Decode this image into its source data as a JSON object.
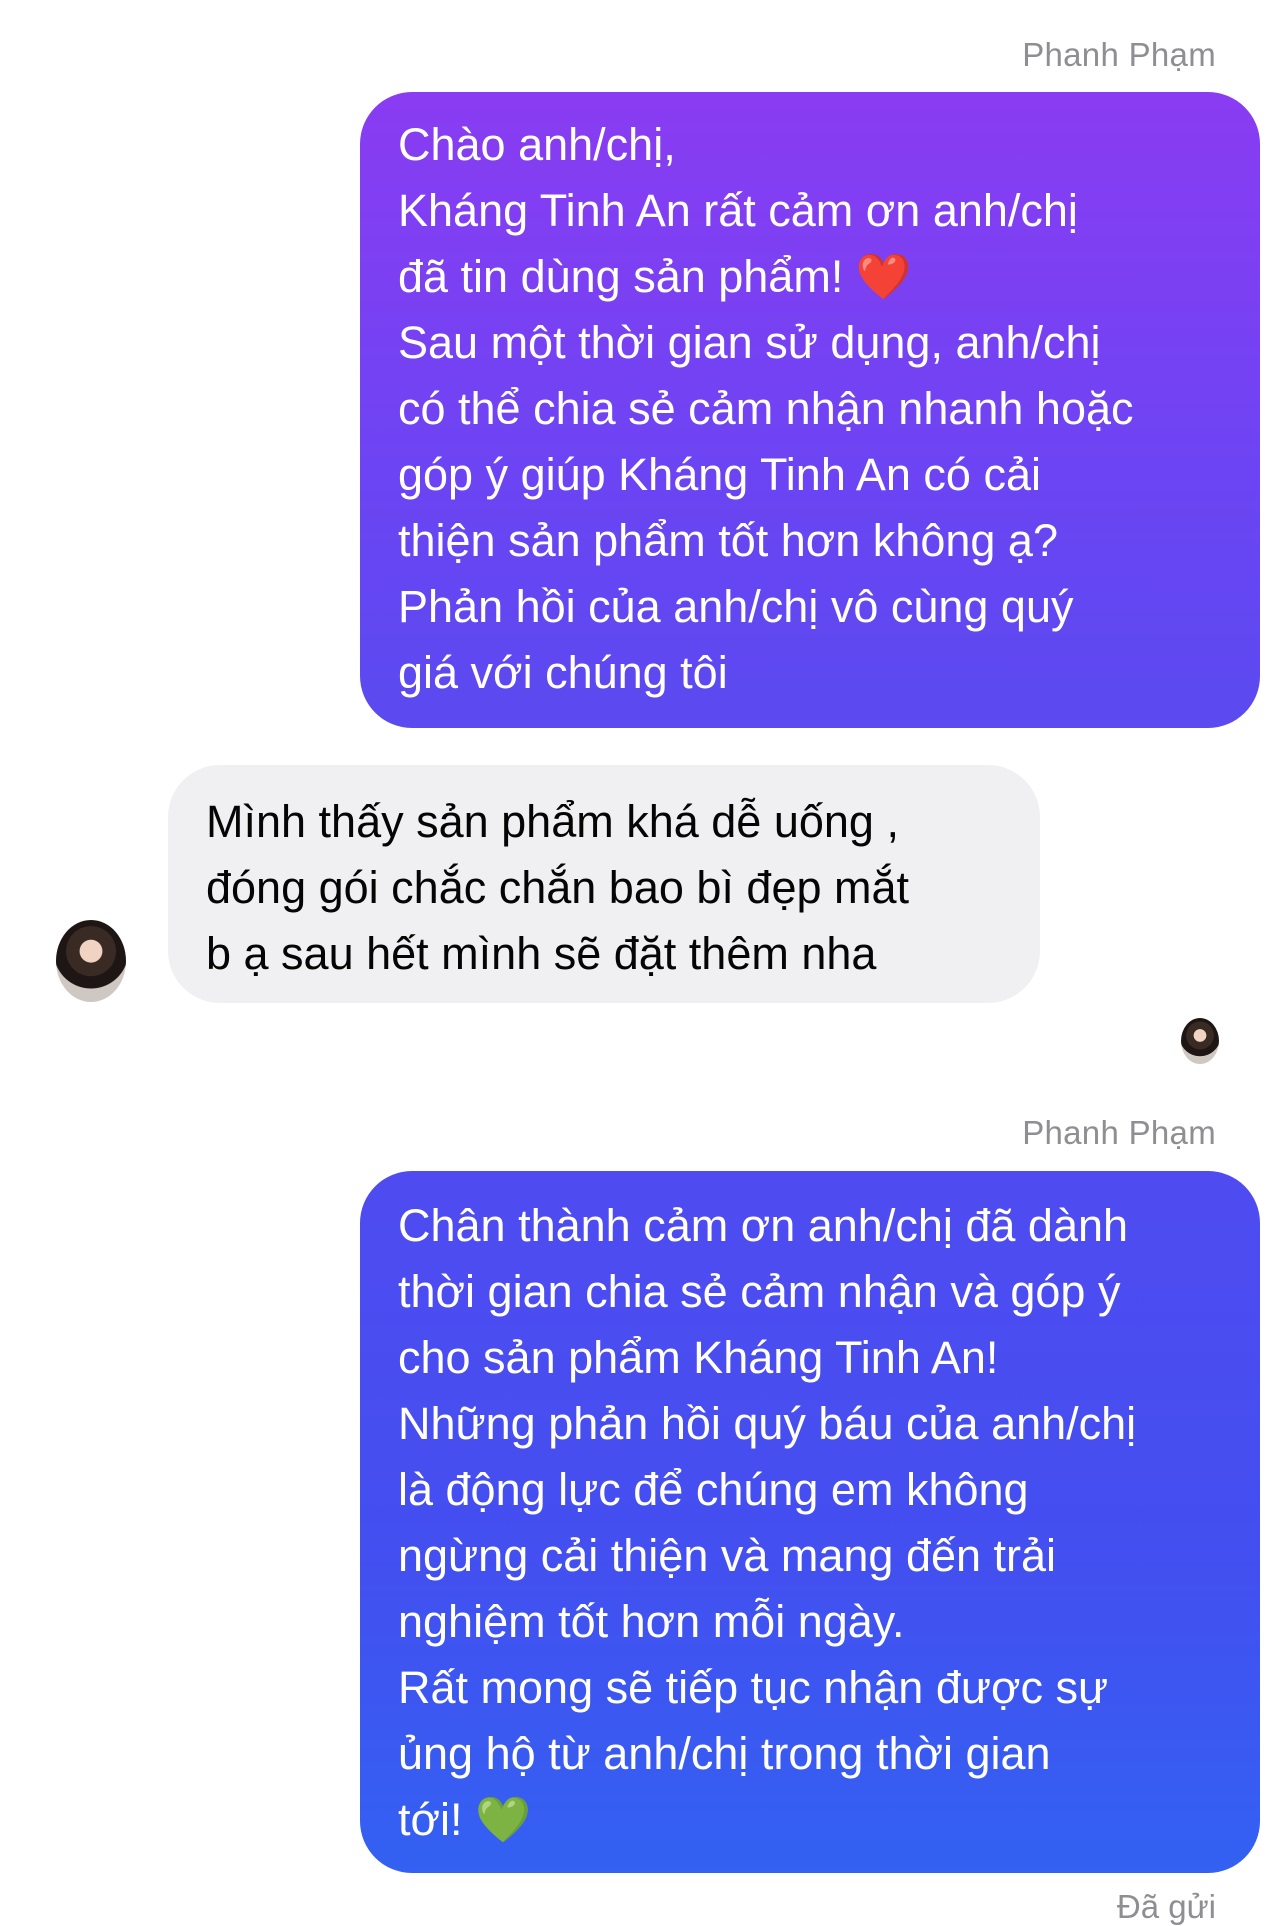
{
  "conversation": {
    "messages": [
      {
        "sender_label": "Phanh Phạm",
        "lines": [
          "Chào anh/chị,",
          "Kháng Tinh An rất cảm ơn anh/chị",
          "đã tin dùng sản phẩm! ❤️",
          "Sau một thời gian sử dụng, anh/chị",
          "có thể chia sẻ cảm nhận nhanh hoặc",
          "góp ý giúp Kháng Tinh An có cải",
          "thiện sản phẩm tốt hơn không ạ?",
          "Phản hồi của anh/chị vô cùng quý",
          "giá với chúng tôi"
        ]
      },
      {
        "lines": [
          "Mình thấy sản phẩm khá dễ uống ,",
          "đóng gói chắc chắn bao bì đẹp mắt",
          "b ạ sau hết mình sẽ đặt thêm nha"
        ]
      },
      {
        "sender_label": "Phanh Phạm",
        "lines": [
          "Chân thành cảm ơn anh/chị đã dành",
          "thời gian chia sẻ cảm nhận và góp ý",
          "cho sản phẩm Kháng Tinh An!",
          "Những phản hồi quý báu của anh/chị",
          "là động lực để chúng em không",
          "ngừng cải thiện và mang đến trải",
          "nghiệm tốt hơn mỗi ngày.",
          "Rất mong sẽ tiếp tục nhận được sự",
          "ủng hộ từ anh/chị trong thời gian",
          "tới! 💚"
        ],
        "status": "Đã gửi"
      }
    ]
  },
  "colors": {
    "outgoing_top": "#8a3cf2",
    "outgoing_bottom": "#3361f2",
    "incoming_bg": "#f0f0f2",
    "meta_text": "#8e8e93"
  }
}
